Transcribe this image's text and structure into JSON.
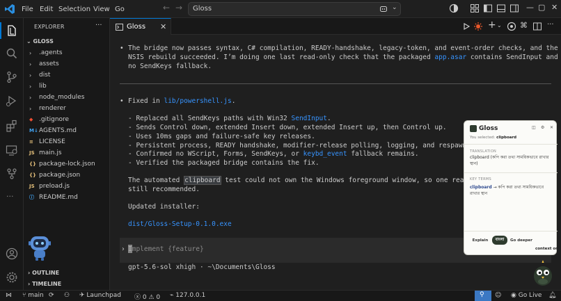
{
  "titlebar": {
    "menu": [
      "File",
      "Edit",
      "Selection",
      "View",
      "Go"
    ],
    "search_value": "Gloss",
    "colors": {
      "vscode_blue": "#2a8fe0"
    }
  },
  "explorer": {
    "title": "EXPLORER",
    "more": "···",
    "root": "GLOSS",
    "items": [
      {
        "name": ".agents",
        "kind": "folder"
      },
      {
        "name": "assets",
        "kind": "folder"
      },
      {
        "name": "dist",
        "kind": "folder"
      },
      {
        "name": "lib",
        "kind": "folder"
      },
      {
        "name": "node_modules",
        "kind": "folder"
      },
      {
        "name": "renderer",
        "kind": "folder"
      },
      {
        "name": ".gitignore",
        "kind": "file",
        "icon": "◆",
        "color": "#f14e32"
      },
      {
        "name": "AGENTS.md",
        "kind": "file",
        "icon": "M↓",
        "color": "#42a5f5"
      },
      {
        "name": "LICENSE",
        "kind": "file",
        "icon": "≡",
        "color": "#e5c07b"
      },
      {
        "name": "main.js",
        "kind": "file",
        "icon": "JS",
        "color": "#e5c07b"
      },
      {
        "name": "package-lock.json",
        "kind": "file",
        "icon": "{}",
        "color": "#e5c07b"
      },
      {
        "name": "package.json",
        "kind": "file",
        "icon": "{}",
        "color": "#e5c07b"
      },
      {
        "name": "preload.js",
        "kind": "file",
        "icon": "JS",
        "color": "#e5c07b"
      },
      {
        "name": "README.md",
        "kind": "file",
        "icon": "ⓘ",
        "color": "#42a5f5"
      }
    ],
    "outline": "OUTLINE",
    "timeline": "TIMELINE"
  },
  "tab": {
    "label": "Gloss",
    "close": "✕"
  },
  "chat": {
    "intro_1": "The bridge now passes syntax, C# compilation, READY-handshake, legacy-token, and event-order checks, and the",
    "intro_2_a": "NSIS rebuild succeeded. I’m doing one last read-only check that the packaged ",
    "intro_2_link": "app.asar",
    "intro_2_b": " contains SendInput and",
    "intro_3": "no SendKeys fallback.",
    "fixed_prefix": "Fixed in ",
    "fixed_link": "lib/powershell.js",
    "fixed_suffix": ".",
    "b1_a": "- Replaced all SendKeys paths with Win32 ",
    "b1_link": "SendInput",
    "b1_b": ".",
    "b2": "- Sends Control down, extended Insert down, extended Insert up, then Control up.",
    "b3": "- Uses 10ms gaps and failure-safe key releases.",
    "b4": "- Persistent process, READY handshake, modifier-release polling, logging, and respawn r",
    "b5_a": "- Confirmed no WScript, Forms, SendKeys, or ",
    "b5_link": "keybd_event",
    "b5_b": " fallback remains.",
    "b6": "- Verified the packaged bridge contains the fix.",
    "auto_a": "The automated ",
    "auto_hl": "clipboard",
    "auto_b": " test could not own the Windows foreground window, so one real l",
    "auto_2": "still recommended.",
    "updated": "Updated installer:",
    "installer": "dist/Gloss-Setup-0.1.0.exe",
    "prompt_chevron": "›",
    "prompt_placeholder": "Implement {feature}",
    "model_line": "gpt-5.6-sol xhigh · ~\\Documents\\Gloss"
  },
  "statusbar": {
    "branch": "main",
    "launchpad": "Launchpad",
    "errors": "0",
    "warnings": "0",
    "port": "127.0.0.1",
    "golive": "Go Live"
  },
  "gloss": {
    "title": "Gloss",
    "selected_label": "You selected:",
    "selected_word": "clipboard",
    "translation_head": "TRANSLATION",
    "translation_text": "clipboard (কপি করা তথ্য সাময়িকভাবে রাখার স্থান)",
    "key_terms_head": "KEY TERMS",
    "key_term_word": "clipboard",
    "key_term_def": " → কপি করা তথ্য সাময়িকভাবে রাখার স্থান",
    "btn_explain": "Explain",
    "btn_lang": "বাংলা",
    "btn_deeper": "Go deeper",
    "context": "context on"
  }
}
